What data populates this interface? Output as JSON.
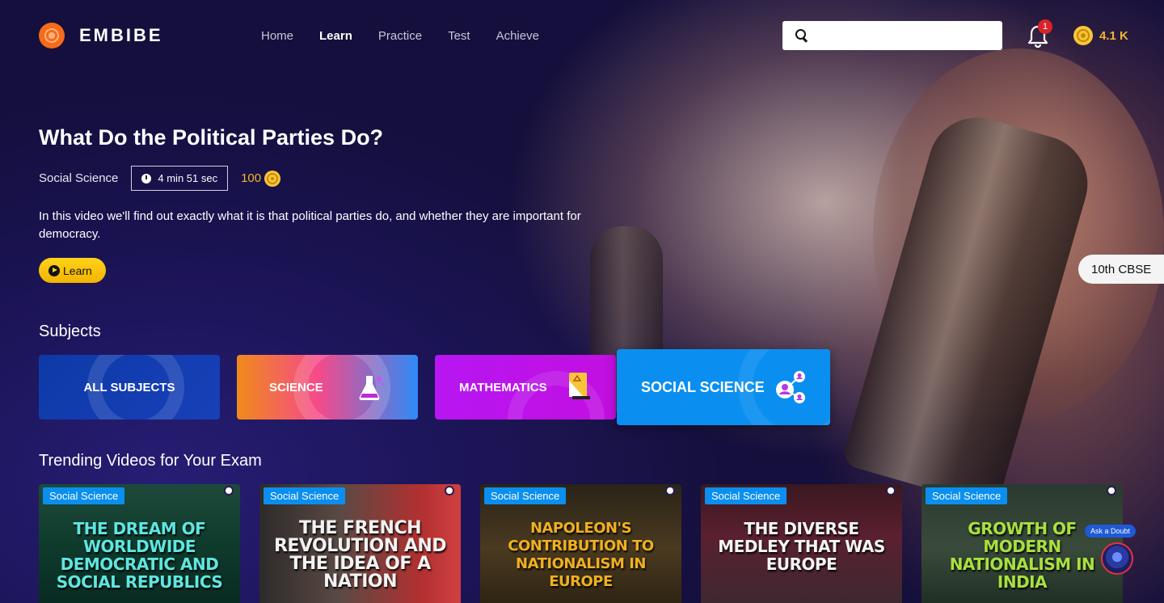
{
  "brand": {
    "name": "EMBIBE"
  },
  "nav": {
    "links": [
      {
        "label": "Home",
        "active": false
      },
      {
        "label": "Learn",
        "active": true
      },
      {
        "label": "Practice",
        "active": false
      },
      {
        "label": "Test",
        "active": false
      },
      {
        "label": "Achieve",
        "active": false
      }
    ]
  },
  "search": {
    "placeholder": "",
    "value": ""
  },
  "notifications": {
    "count": "1"
  },
  "coins": {
    "balance": "4.1 K"
  },
  "hero": {
    "title": "What Do the Political Parties Do?",
    "subject": "Social Science",
    "duration": "4 min 51 sec",
    "reward": "100",
    "description": "In this video we'll find out exactly what it is that political parties do, and whether they are important for democracy.",
    "cta_label": "Learn",
    "exam_badge": "10th CBSE"
  },
  "subjects": {
    "heading": "Subjects",
    "items": [
      {
        "label": "ALL SUBJECTS",
        "icon": "none"
      },
      {
        "label": "SCIENCE",
        "icon": "flask-icon"
      },
      {
        "label": "MATHEMATICS",
        "icon": "ruler-icon"
      },
      {
        "label": "SOCIAL SCIENCE",
        "icon": "people-network-icon",
        "selected": true
      }
    ]
  },
  "trending": {
    "heading": "Trending Videos for Your Exam",
    "videos": [
      {
        "tag": "Social Science",
        "title": "THE DREAM OF WORLDWIDE DEMOCRATIC AND SOCIAL REPUBLICS"
      },
      {
        "tag": "Social Science",
        "title": "THE FRENCH REVOLUTION AND THE IDEA OF A NATION"
      },
      {
        "tag": "Social Science",
        "title": "NAPOLEON'S CONTRIBUTION TO NATIONALISM IN EUROPE"
      },
      {
        "tag": "Social Science",
        "title": "THE DIVERSE MEDLEY THAT WAS EUROPE"
      },
      {
        "tag": "Social Science",
        "title": "GROWTH OF MODERN NATIONALISM IN INDIA"
      }
    ]
  },
  "doubt": {
    "label": "Ask a Doubt"
  },
  "colors": {
    "accent": "#0a8ff0",
    "cta": "#ffc20e",
    "coin": "#f3b62b",
    "badge": "#d8232a"
  }
}
